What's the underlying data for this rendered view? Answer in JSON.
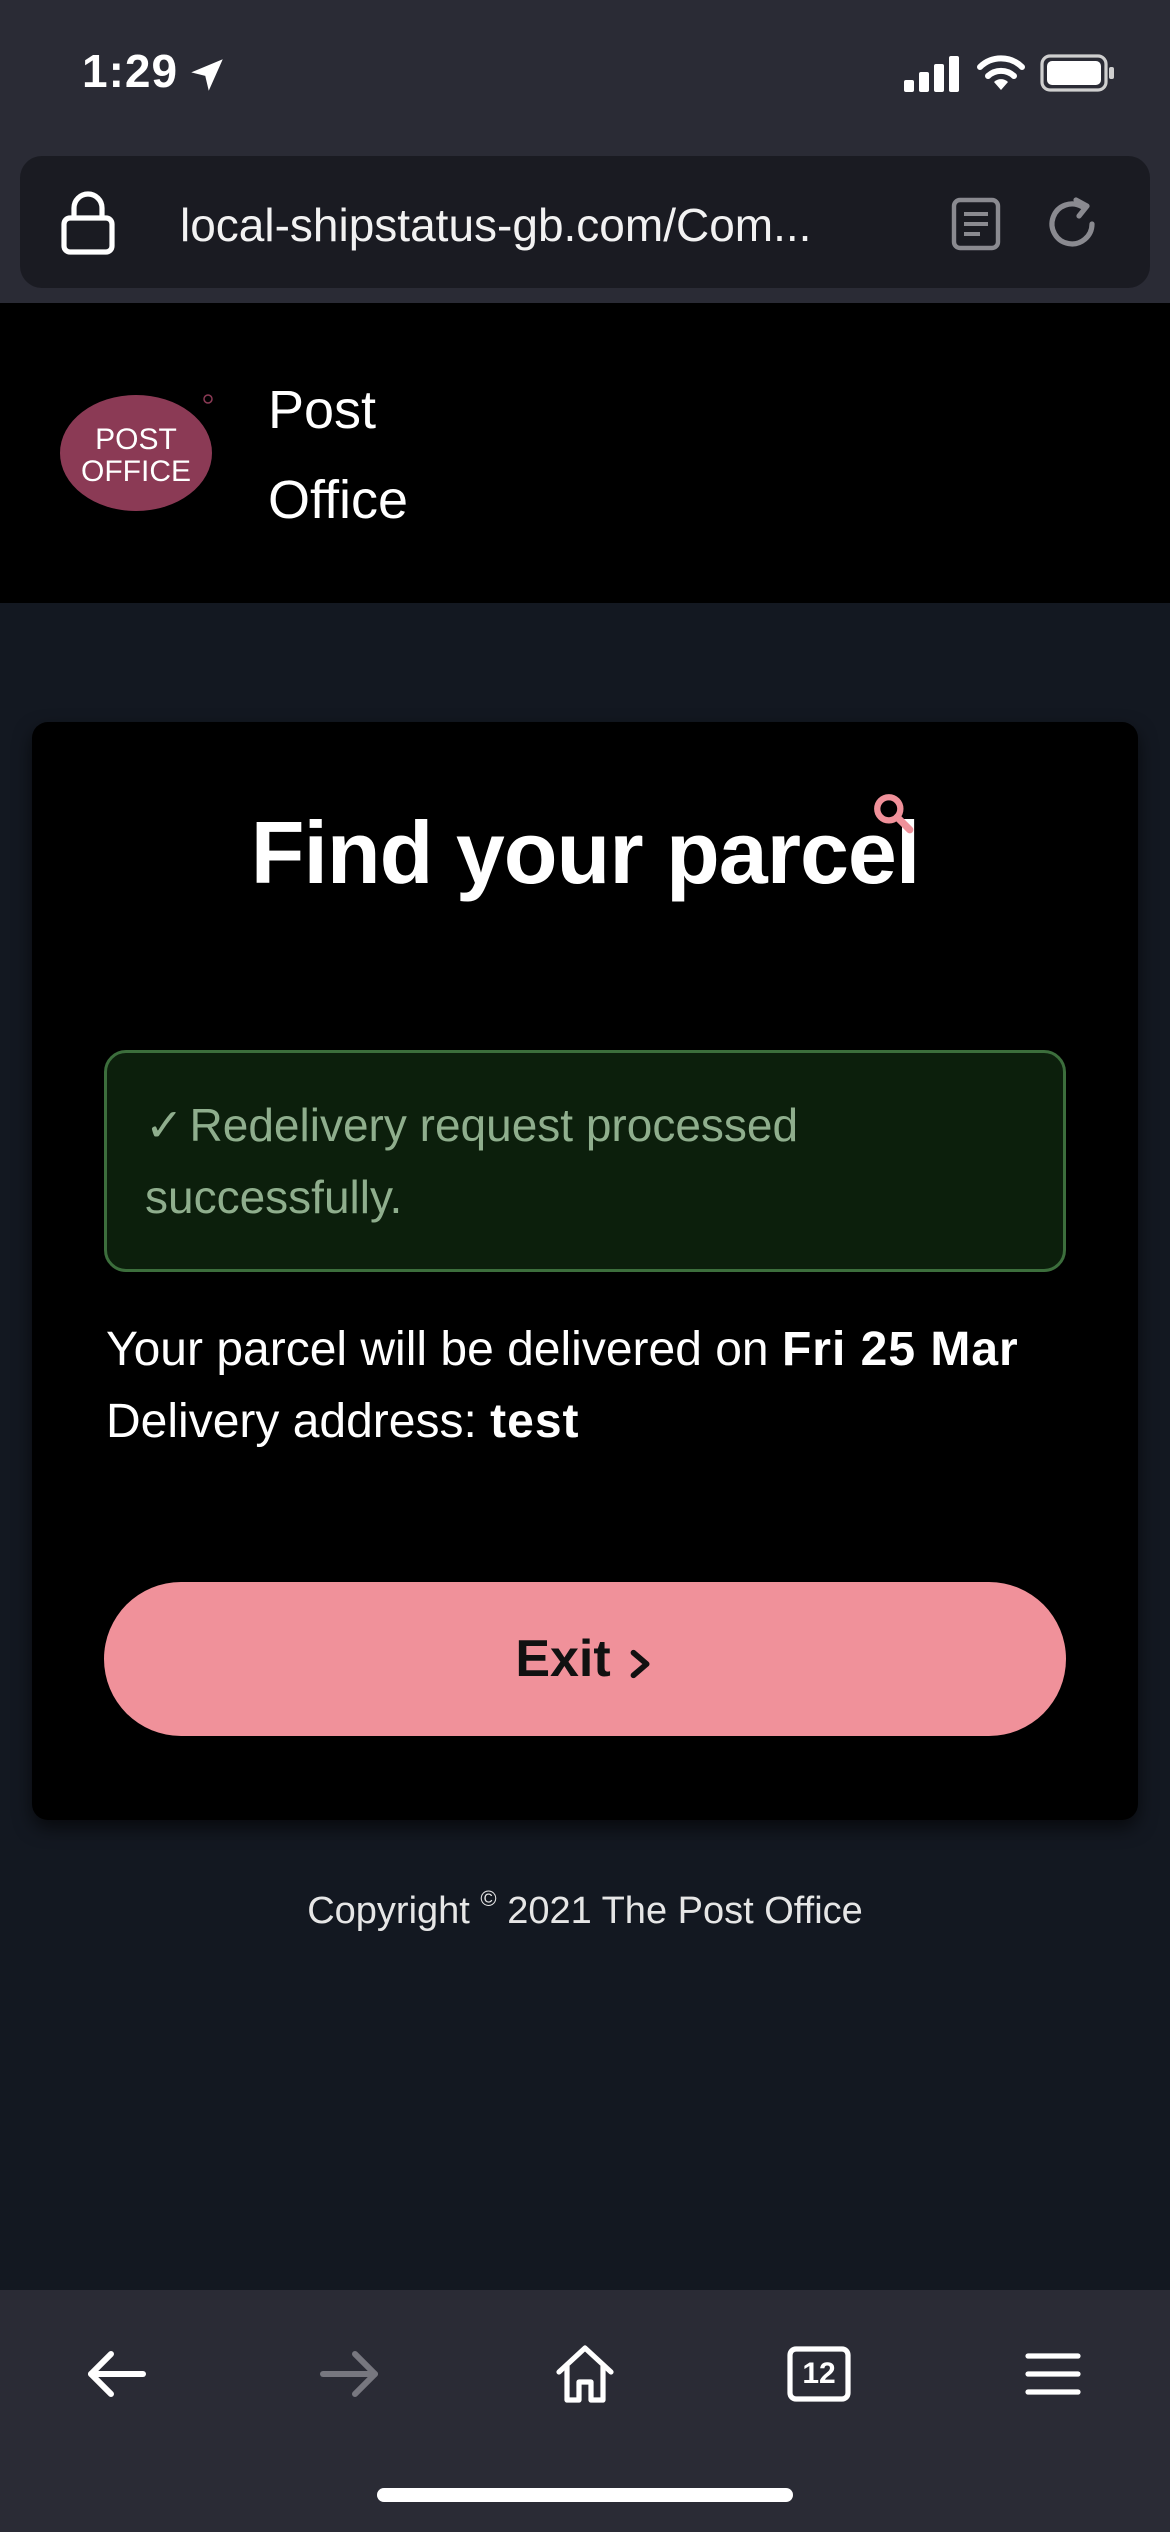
{
  "status_bar": {
    "time": "1:29",
    "icons": [
      "location-arrow-icon",
      "cellular-signal-icon",
      "wifi-icon",
      "battery-icon"
    ]
  },
  "browser": {
    "url": "local-shipstatus-gb.com/Com...",
    "icons": [
      "lock-icon",
      "reader-mode-icon",
      "reload-icon"
    ],
    "toolbar": {
      "tabs_count": "12",
      "icons": [
        "back-arrow-icon",
        "forward-arrow-icon",
        "home-icon",
        "tabs-icon",
        "menu-icon"
      ]
    }
  },
  "header": {
    "logo_text_line1": "POST",
    "logo_text_line2": "OFFICE",
    "brand_line1": "Post",
    "brand_line2": "Office"
  },
  "card": {
    "title": "Find your parcel",
    "success": {
      "check": "✓",
      "message": "Redelivery request processed successfully."
    },
    "delivery_date_label": "Your parcel will be delivered on",
    "delivery_date": "Fri 25 Mar",
    "address_label": "Delivery address:",
    "address": "test",
    "exit_button_label": "Exit"
  },
  "footer": {
    "copyright_prefix": "Copyright",
    "copyright_symbol": "©",
    "copyright_suffix": "2021 The Post Office"
  },
  "colors": {
    "page_bg": "#131821",
    "chrome_bg": "#2a2b35",
    "accent_pink": "#f0919a",
    "logo_maroon": "#8b3a55",
    "success_bg": "#0c1f0c",
    "success_border": "#3c6e3c",
    "success_text": "#8fae8d"
  }
}
